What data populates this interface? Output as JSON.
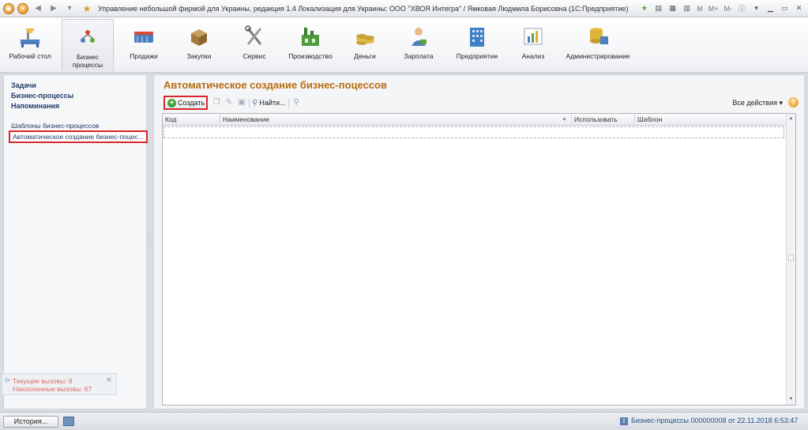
{
  "window": {
    "title": "Управление небольшой фирмой для Украины, редакция 1.4 Локализация для Украины: ООО \"ХВОЯ Интегра\" / Ямковая Людмила Борисовна  (1С:Предприятие)",
    "m_label": "M",
    "mplus_label": "M+",
    "mminus_label": "M-"
  },
  "sections": [
    {
      "label": "Рабочий стол",
      "icon": "desk-icon"
    },
    {
      "label": "Бизнес процессы",
      "icon": "business-process-icon"
    },
    {
      "label": "Продажи",
      "icon": "sales-icon"
    },
    {
      "label": "Закупки",
      "icon": "purchases-icon"
    },
    {
      "label": "Сервис",
      "icon": "service-icon"
    },
    {
      "label": "Производство",
      "icon": "production-icon"
    },
    {
      "label": "Деньги",
      "icon": "money-icon"
    },
    {
      "label": "Зарплата",
      "icon": "salary-icon"
    },
    {
      "label": "Предприятие",
      "icon": "enterprise-icon"
    },
    {
      "label": "Анализ",
      "icon": "analysis-icon"
    },
    {
      "label": "Администрирование",
      "icon": "administration-icon"
    }
  ],
  "nav": {
    "tasks": "Задачи",
    "business_processes": "Бизнес-процессы",
    "reminders": "Напоминания",
    "templates": "Шаблоны бизнес-процессов",
    "auto_creation": "Автоматическое создание бизнес-поцес..."
  },
  "calls": {
    "current": "Текущие вызовы: 8",
    "accumulated": "Накопленные вызовы: 67"
  },
  "main": {
    "title": "Автоматическое создание бизнес-поцессов",
    "create_label": "Создать",
    "find_label": "Найти...",
    "all_actions": "Все действия ▾",
    "columns": [
      "Код",
      "Наименование",
      "Использовать",
      "Шаблон"
    ]
  },
  "status": {
    "history_label": "История...",
    "message": "Бизнес-процессы 000000008 от 22.11.2018 6:53:47"
  },
  "colors": {
    "accent_title": "#b86c10",
    "highlight_border": "#d8242c",
    "link": "#1f3b66"
  }
}
